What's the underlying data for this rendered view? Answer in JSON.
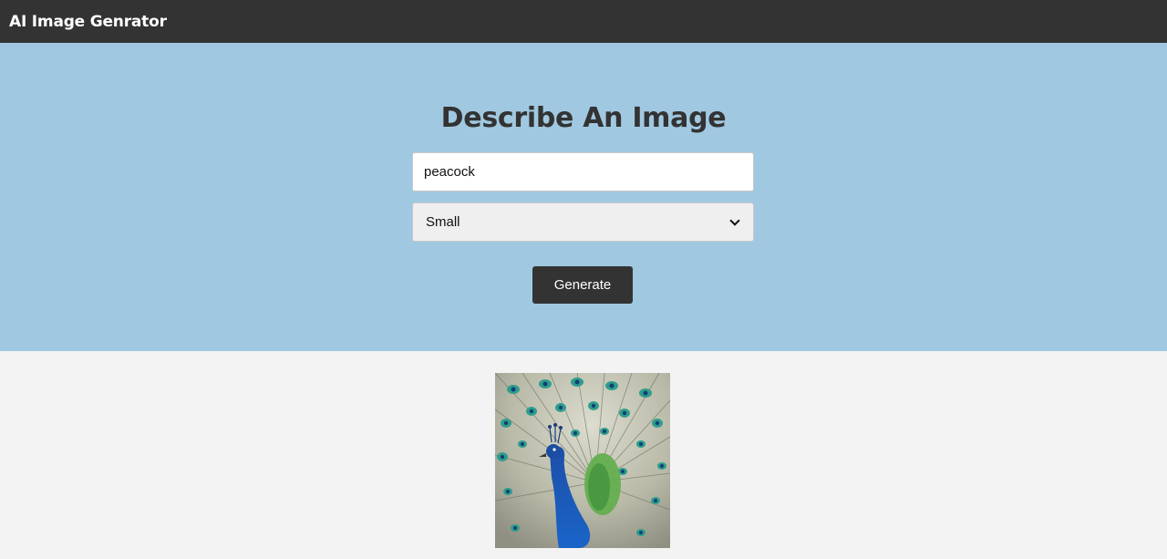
{
  "navbar": {
    "logo": "AI Image Genrator"
  },
  "hero": {
    "title": "Describe An Image",
    "prompt_value": "peacock",
    "size_selected": "Small",
    "generate_label": "Generate"
  },
  "result": {
    "subject": "peacock-image"
  },
  "colors": {
    "navbar": "#333333",
    "hero": "#a0c9e1",
    "page": "#f3f3f3",
    "button": "#333333"
  }
}
